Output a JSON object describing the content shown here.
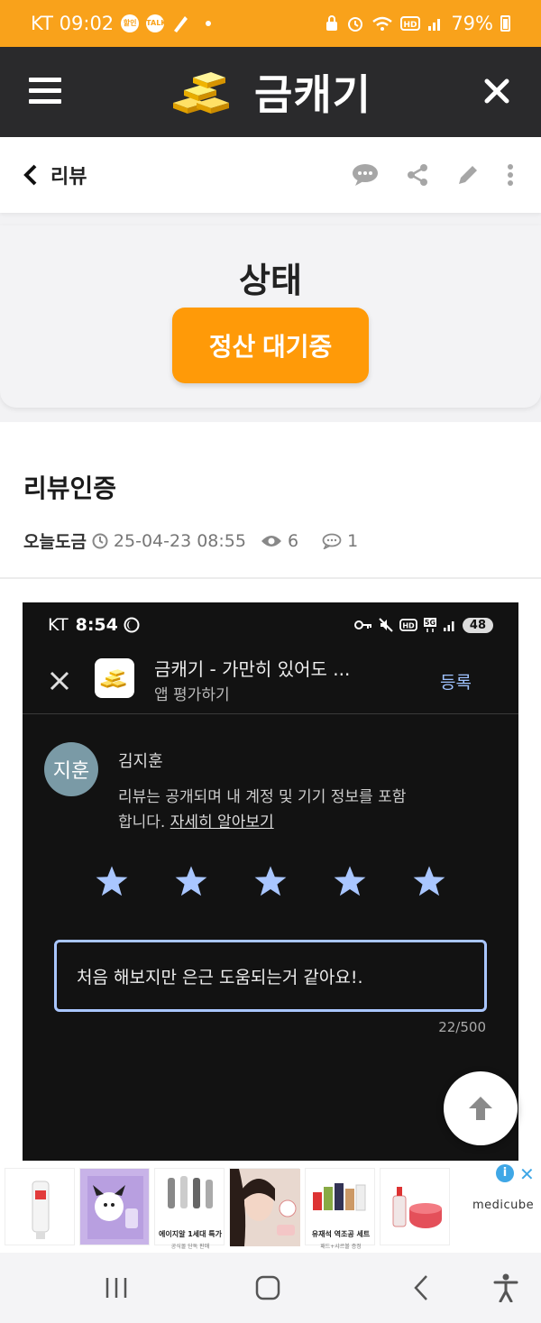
{
  "status_bar": {
    "carrier_time": "KT 09:02",
    "icon1": "할인",
    "icon2": "TALK",
    "battery": "79%"
  },
  "app_header": {
    "brand_name": "금캐기"
  },
  "sub_header": {
    "back_label": "리뷰"
  },
  "status_card": {
    "title": "상태",
    "button_label": "정산 대기중"
  },
  "post": {
    "title": "리뷰인증",
    "author": "오늘도금",
    "datetime": "25-04-23 08:55",
    "views": "6",
    "comments": "1"
  },
  "screenshot": {
    "carrier": "KT",
    "time": "8:54",
    "battery": "48",
    "app_title": "금캐기 - 가만히 있어도 ...",
    "app_subtitle": "앱 평가하기",
    "register_label": "등록",
    "avatar_text": "지훈",
    "user_name": "김지훈",
    "desc": "리뷰는 공개되며 내 계정 및 기기 정보를 포함합니다.",
    "learn_more": "자세히 알아보기",
    "rating": 5,
    "review_text": "처음 해보지만 은근 도움되는거 같아요!.",
    "char_count": "22/500"
  },
  "ads": {
    "items": [
      {
        "caption": "",
        "sub": ""
      },
      {
        "caption": "",
        "sub": ""
      },
      {
        "caption": "에이지알 1세대 특가",
        "sub": "공식몰 단독 판매"
      },
      {
        "caption": "",
        "sub": ""
      },
      {
        "caption": "유재석 역조공 세트",
        "sub": "패드+샤르볼 증정"
      },
      {
        "caption": "",
        "sub": ""
      }
    ],
    "brand": "medicube"
  },
  "colors": {
    "accent": "#f9a21b",
    "button": "#ff9a08",
    "header": "#2a2a2c",
    "star": "#a9c6ff"
  }
}
